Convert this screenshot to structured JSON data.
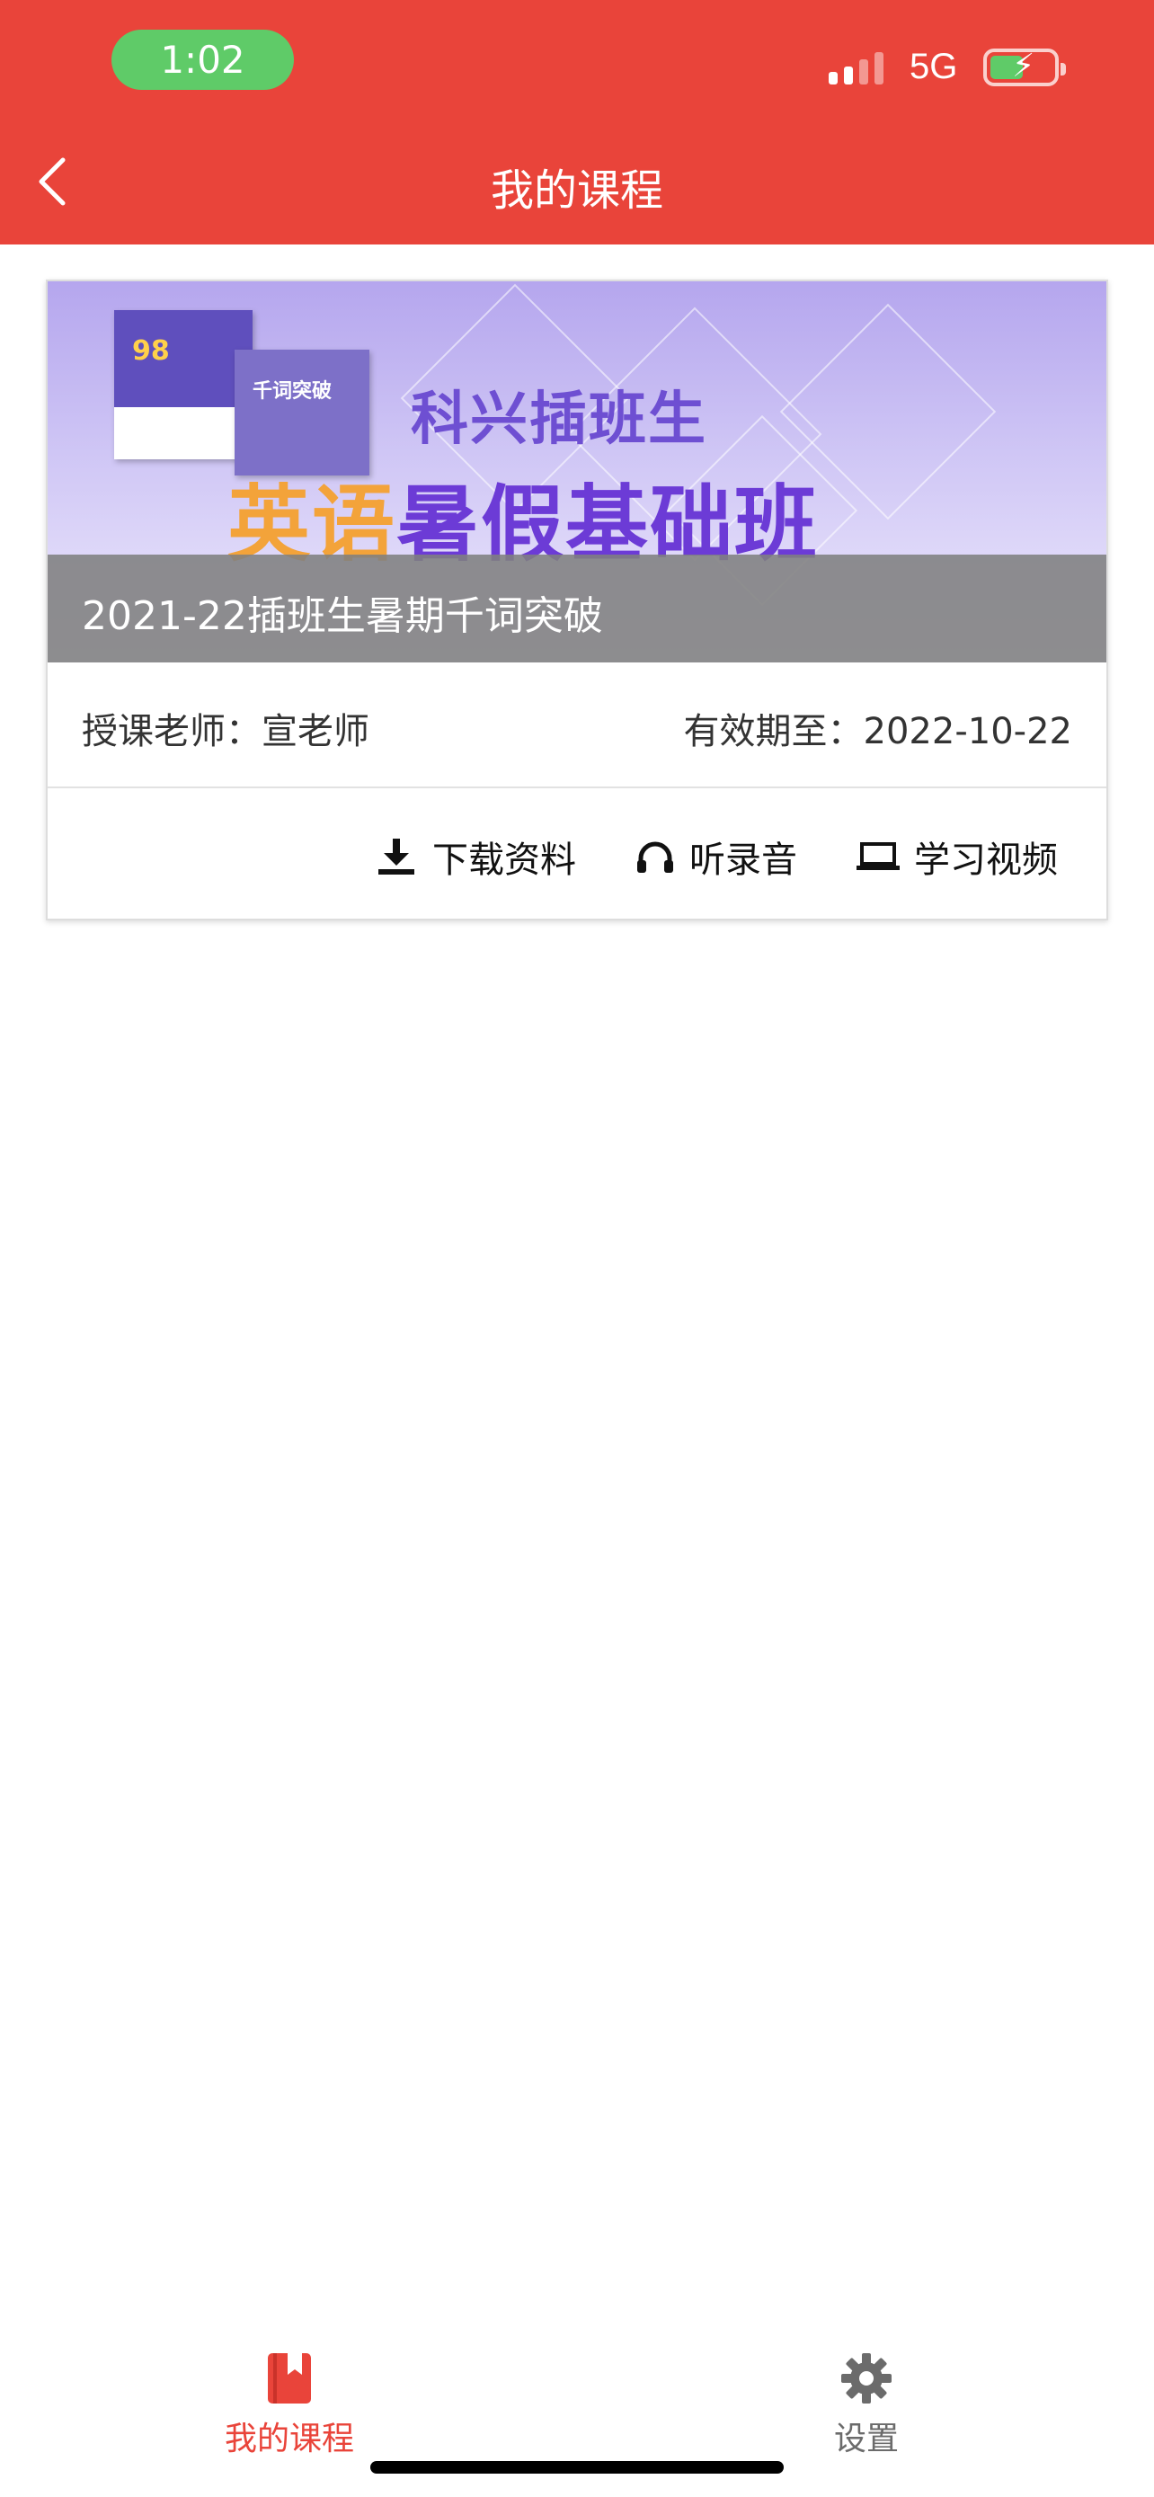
{
  "status_bar": {
    "time": "1:02",
    "network": "5G"
  },
  "header": {
    "title": "我的课程",
    "back_icon": "chevron-left-icon"
  },
  "course": {
    "banner": {
      "book1_number": "98",
      "book2_title": "千词突破",
      "subtitle": "科兴插班生",
      "main_orange": "英语",
      "main_purple": "暑假基础班",
      "colors": {
        "purple": "#6c3bd6",
        "orange": "#f3a33a"
      }
    },
    "title": "2021-22插班生暑期千词突破",
    "teacher": "授课老师：宣老师",
    "expiry": "有效期至：2022-10-22",
    "actions": [
      {
        "label": "下载资料",
        "icon": "download-icon"
      },
      {
        "label": "听录音",
        "icon": "headphones-icon"
      },
      {
        "label": "学习视频",
        "icon": "laptop-icon"
      }
    ]
  },
  "tabbar": {
    "items": [
      {
        "label": "我的课程",
        "icon": "book-icon",
        "active": true,
        "color": "#e9443a"
      },
      {
        "label": "设置",
        "icon": "gear-icon",
        "active": false,
        "color": "#6b6b6b"
      }
    ]
  },
  "colors": {
    "brand": "#e9443a",
    "status_pill": "#5fcb68"
  }
}
